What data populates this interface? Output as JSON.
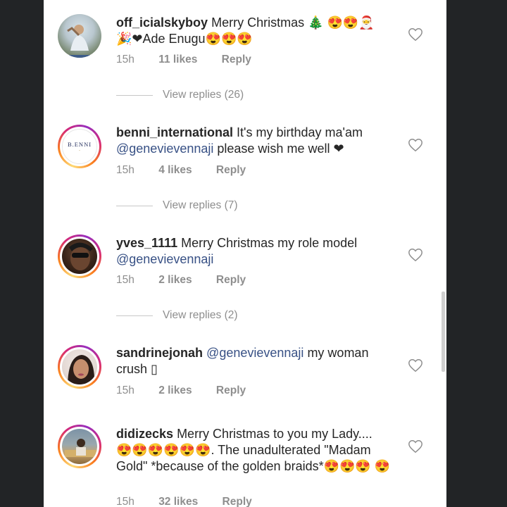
{
  "comments": [
    {
      "username": "off_icialskyboy",
      "text_parts": [
        "Merry Christmas 🎄 😍😍🎅 🎉❤Ade Enugu😍😍😍"
      ],
      "time": "15h",
      "likes": "11 likes",
      "reply": "Reply",
      "view_replies": "View replies (26)",
      "avatar_icon": "photo-avatar"
    },
    {
      "username": "benni_international",
      "text_before": "It's my birthday ma'am",
      "mention": "@genevievennaji",
      "text_after": "please wish me well ❤",
      "time": "15h",
      "likes": "4 likes",
      "reply": "Reply",
      "view_replies": "View replies (7)",
      "logo_text": "B.ENNI"
    },
    {
      "username": "yves_1111",
      "text_before": "Merry Christmas my role model",
      "mention": "@genevievennaji",
      "time": "15h",
      "likes": "2 likes",
      "reply": "Reply",
      "view_replies": "View replies (2)"
    },
    {
      "username": "sandrinejonah",
      "mention": "@genevievennaji",
      "text_after": "my woman crush ▯",
      "time": "15h",
      "likes": "2 likes",
      "reply": "Reply"
    },
    {
      "username": "didizecks",
      "text_before": "Merry Christmas to you my Lady.... 😍😍😍😍😍😍. The unadulterated \"Madam Gold\" *because of the golden braids*😍😍😍 😍",
      "time": "15h",
      "likes": "32 likes",
      "reply": "Reply"
    }
  ],
  "colors": {
    "text": "#262626",
    "meta": "#8e8e8e",
    "mention": "#385185",
    "background": "#ffffff",
    "frame": "#222426"
  }
}
